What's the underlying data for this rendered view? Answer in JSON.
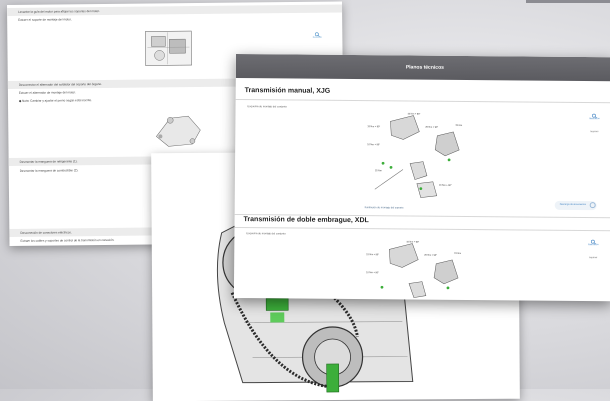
{
  "colors": {
    "header_bg": "#5f5f64",
    "link_blue": "#3a7fc1",
    "bolt_green": "#3cae3a"
  },
  "back_sheet": {
    "rows": [
      "Levantar la guía del motor para aflojar los soportes del motor.",
      "Extraer el soporte de montaje del motor.",
      "Desconectar el alternador del soldador del soporte del órgano.",
      "Extraer el alternador de montaje del motor.",
      "Nota: Cambiar y ajustar el perno según está inscrito.",
      "Desmontar la manguera de refrigerante (1).",
      "Desmontar la manguera de combustible (2).",
      "Desconexión de conectores eléctricos.",
      "Extraer los cables y soportes de control de la transmisión en conexión."
    ],
    "link_label": "Ilustración"
  },
  "window": {
    "header_title": "Planos técnicos",
    "sections": [
      {
        "title": "Transmisión manual, XJG",
        "sub_label": "Esquema de montaje del conjunto",
        "caption": "Ilustración de montaje del soporte",
        "download_label": "Descarga de documentos",
        "torques": [
          "10 Nm + 90°",
          "15 Nm + 90°",
          "10 Nm + 90°",
          "20 Nm + 90°",
          "15 Nm",
          "25 Nm",
          "10 Nm + 90°"
        ]
      },
      {
        "title": "Transmisión de doble embrague, XDL",
        "sub_label": "Esquema de montaje del conjunto",
        "torques": [
          "10 Nm + 90°",
          "15 Nm + 90°",
          "10 Nm + 90°",
          "20 Nm + 90°",
          "15 Nm"
        ]
      }
    ],
    "side_buttons": {
      "illustration": "Ilustración",
      "print": "Imprimir"
    }
  }
}
